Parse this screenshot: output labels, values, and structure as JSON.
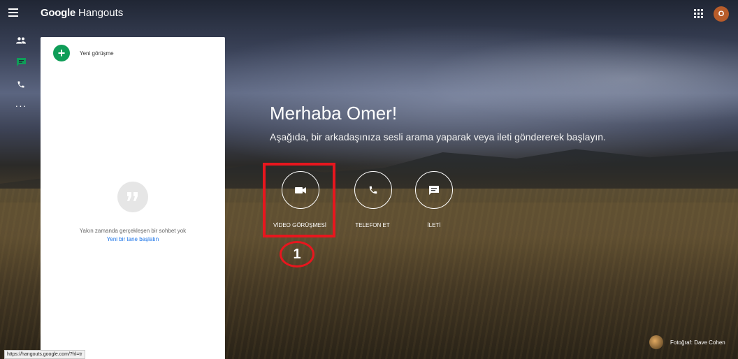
{
  "app": {
    "brand_prefix": "Google",
    "brand_name": "Hangouts",
    "avatar_letter": "O"
  },
  "rail": {
    "items": [
      {
        "icon": "people-icon",
        "label": ""
      },
      {
        "icon": "chat-icon",
        "label": "",
        "active": true
      },
      {
        "icon": "phone-icon",
        "label": ""
      },
      {
        "icon": "more-icon",
        "label": ""
      }
    ],
    "more_glyph": "···"
  },
  "panel": {
    "new_conversation_label": "Yeni görüşme",
    "empty_message": "Yakın zamanda gerçekleşen bir sohbet yok",
    "empty_link": "Yeni bir tane başlatın"
  },
  "main": {
    "greeting": "Merhaba Omer!",
    "subtitle": "Aşağıda, bir arkadaşınıza sesli arama yaparak veya ileti göndererek başlayın.",
    "actions": [
      {
        "label": "VİDEO GÖRÜŞMESİ",
        "icon": "video-camera-icon"
      },
      {
        "label": "TELEFON ET",
        "icon": "phone-icon"
      },
      {
        "label": "İLETİ",
        "icon": "message-icon"
      }
    ],
    "annotation_step": "1"
  },
  "footer": {
    "photo_credit": "Fotoğraf: Dave Cohen",
    "status_url": "https://hangouts.google.com/?hl=tr"
  },
  "colors": {
    "accent_green": "#0f9d58",
    "link_blue": "#1a73e8",
    "annotation_red": "#e8161e",
    "avatar_bg": "#b85c2a"
  }
}
